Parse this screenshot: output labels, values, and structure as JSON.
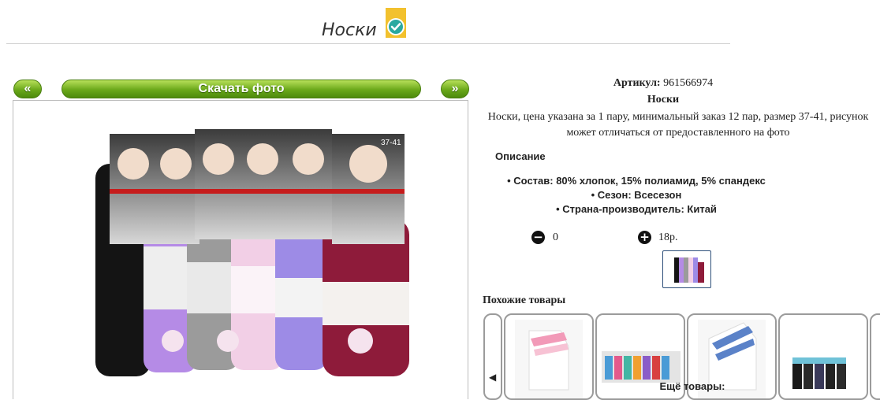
{
  "header": {
    "title": "Носки"
  },
  "gallery": {
    "prev_label": "«",
    "next_label": "»",
    "download_label": "Скачать фото",
    "photo_alt": "Носки (6 пар) – черные, сиреневые, серые, розовые, голубые, бордовые",
    "size_tag": "37-41"
  },
  "product": {
    "sku_label": "Артикул:",
    "sku_value": "961566974",
    "name": "Носки",
    "description": "Носки, цена указана за 1 пару, минимальный заказ 12 пар, размер 37-41, рисунок может отличаться от предоставленного на фото",
    "description_heading": "Описание",
    "properties": [
      "Состав: 80% хлопок, 15% полиамид, 5% спандекс",
      "Сезон: Всесезон",
      "Страна-производитель: Китай"
    ],
    "quantity": "0",
    "price": "18р."
  },
  "similar": {
    "heading": "Похожие товары"
  },
  "more": {
    "heading": "Ещё товары:"
  },
  "colors": {
    "accent_green": "#6aa81a",
    "badge_yellow": "#f2c12e",
    "badge_teal": "#2aa9a0"
  }
}
